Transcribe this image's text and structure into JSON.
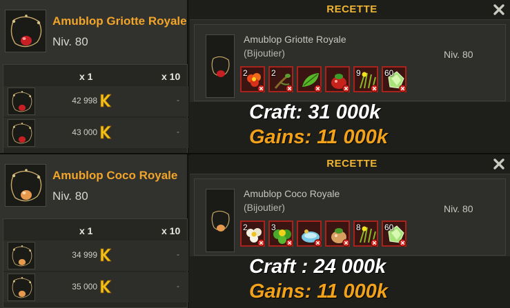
{
  "colors": {
    "item_name": "#f2a52a",
    "recipe_title": "#f0b531",
    "gains": "#f2a21a",
    "ingredient_missing_border": "#a8231c",
    "kama_gold": "#f2c21a"
  },
  "icons": {
    "currency": "kama-icon",
    "close": "close-icon",
    "missing": "missing-ingredient-icon"
  },
  "sections": [
    {
      "item": {
        "name": "Amublop Griotte Royale",
        "level": "Niv. 80"
      },
      "prices": {
        "col_x1": "x 1",
        "col_x10": "x 10",
        "rows": [
          {
            "price": "42 998",
            "x10": "-"
          },
          {
            "price": "43 000",
            "x10": "-"
          }
        ]
      },
      "recipe": {
        "title": "RECETTE",
        "name": "Amublop Griotte Royale",
        "job": "(Bijoutier)",
        "level": "Niv. 80",
        "ingredients": [
          {
            "qty": "2",
            "icon": "red-flower-icon"
          },
          {
            "qty": "2",
            "icon": "root-icon"
          },
          {
            "qty": "",
            "icon": "green-leaf-icon"
          },
          {
            "qty": "",
            "icon": "red-blop-icon"
          },
          {
            "qty": "9",
            "icon": "grass-icon"
          },
          {
            "qty": "60",
            "icon": "green-crystal-icon"
          }
        ],
        "craft": "Craft: 31 000k",
        "gains": "Gains: 11 000k"
      }
    },
    {
      "item": {
        "name": "Amublop Coco Royale",
        "level": "Niv. 80"
      },
      "prices": {
        "col_x1": "x 1",
        "col_x10": "x 10",
        "rows": [
          {
            "price": "34 999",
            "x10": "-"
          },
          {
            "price": "35 000",
            "x10": "-"
          }
        ]
      },
      "recipe": {
        "title": "RECETTE",
        "name": "Amublop Coco Royale",
        "job": "(Bijoutier)",
        "level": "Niv. 80",
        "ingredients": [
          {
            "qty": "2",
            "icon": "white-flower-icon"
          },
          {
            "qty": "3",
            "icon": "green-flower-icon"
          },
          {
            "qty": "",
            "icon": "water-icon"
          },
          {
            "qty": "",
            "icon": "coco-blop-icon"
          },
          {
            "qty": "8",
            "icon": "grass-icon"
          },
          {
            "qty": "60",
            "icon": "green-crystal-icon"
          }
        ],
        "craft": "Craft : 24 000k",
        "gains": "Gains: 11 000k"
      }
    }
  ]
}
